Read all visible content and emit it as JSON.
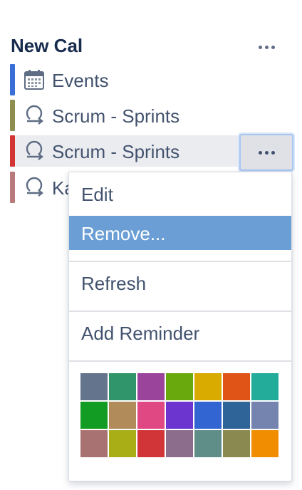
{
  "calendar": {
    "title": "New Cal",
    "header_more_icon": "more-horizontal-icon"
  },
  "items": [
    {
      "label": "Events",
      "color": "#3a6fd8",
      "icon": "calendar-icon"
    },
    {
      "label": "Scrum - Sprints",
      "color": "#8e8e50",
      "icon": "sprint-cycle-icon"
    },
    {
      "label": "Scrum - Sprints",
      "color": "#d33434",
      "icon": "sprint-cycle-icon",
      "selected": true
    },
    {
      "label": "Ka",
      "color": "#b87a7a",
      "icon": "sprint-cycle-icon"
    }
  ],
  "row_more_icon": "more-horizontal-icon",
  "menu": {
    "items": [
      {
        "label": "Edit"
      },
      {
        "label": "Remove...",
        "highlighted": true
      },
      {
        "label": "Refresh"
      },
      {
        "label": "Add Reminder"
      }
    ],
    "swatches": [
      "#64748c",
      "#30956a",
      "#9b449c",
      "#6aa90e",
      "#d9aa00",
      "#e05517",
      "#22ac99",
      "#139c23",
      "#b18b59",
      "#e04883",
      "#6d35cf",
      "#3265d2",
      "#2f6498",
      "#7484ae",
      "#a87272",
      "#a9ae17",
      "#d13537",
      "#8c6d8c",
      "#5f8e88",
      "#898950",
      "#f08d00"
    ]
  }
}
